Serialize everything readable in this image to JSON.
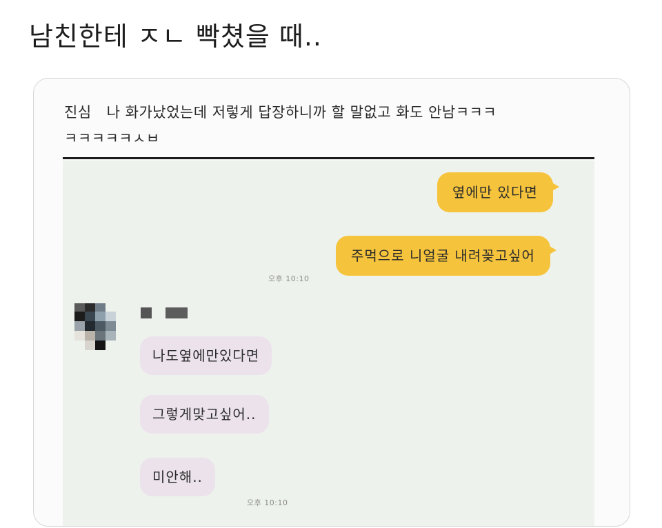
{
  "post": {
    "title": "남친한테 ㅈㄴ 빡쳤을 때.."
  },
  "caption": {
    "prefix": "진심",
    "line1": "나 화가났었는데 저렇게 답장하니까 할 말없고 화도 안남ㅋㅋㅋ",
    "line2": "ㅋㅋㅋㅋㅋㅅㅂ"
  },
  "chat": {
    "sent": [
      {
        "text": "옆에만 있다면"
      },
      {
        "text": "주먹으로 니얼굴 내려꽂고싶어"
      }
    ],
    "sent_time": "오후 10:10",
    "sender_name": "▪ ▬",
    "received": [
      {
        "text": "나도옆에만있다면"
      },
      {
        "text": "그렇게맞고싶어.."
      },
      {
        "text": "미안해.."
      }
    ],
    "received_time": "오후 10:10"
  },
  "colors": {
    "sent_bubble": "#f5c43c",
    "received_bubble": "#ebe2ec",
    "chat_background": "#eef2ec"
  },
  "icons": {
    "avatar": "pixelated-avatar",
    "name": "pixelated-name"
  }
}
